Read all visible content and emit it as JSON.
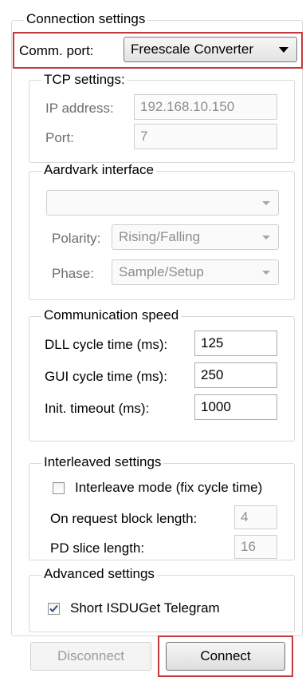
{
  "connection": {
    "title": "Connection settings",
    "comm_port_label": "Comm. port:",
    "comm_port_value": "Freescale Converter"
  },
  "tcp": {
    "title": "TCP settings:",
    "ip_label": "IP address:",
    "ip_value": "192.168.10.150",
    "port_label": "Port:",
    "port_value": "7"
  },
  "aardvark": {
    "title": "Aardvark interface",
    "device_value": "",
    "polarity_label": "Polarity:",
    "polarity_value": "Rising/Falling",
    "phase_label": "Phase:",
    "phase_value": "Sample/Setup"
  },
  "speed": {
    "title": "Communication speed",
    "dll_label": "DLL cycle time (ms):",
    "dll_value": "125",
    "gui_label": "GUI cycle time (ms):",
    "gui_value": "250",
    "init_label": "Init. timeout (ms):",
    "init_value": "1000"
  },
  "interleaved": {
    "title": "Interleaved settings",
    "mode_label": "Interleave mode (fix cycle time)",
    "mode_checked": false,
    "block_label": "On request block length:",
    "block_value": "4",
    "slice_label": "PD slice length:",
    "slice_value": "16"
  },
  "advanced": {
    "title": "Advanced settings",
    "short_label": "Short ISDUGet Telegram",
    "short_checked": true
  },
  "buttons": {
    "disconnect": "Disconnect",
    "connect": "Connect"
  },
  "colors": {
    "highlight": "#c5393c",
    "checkmark": "#2e4f8a"
  }
}
